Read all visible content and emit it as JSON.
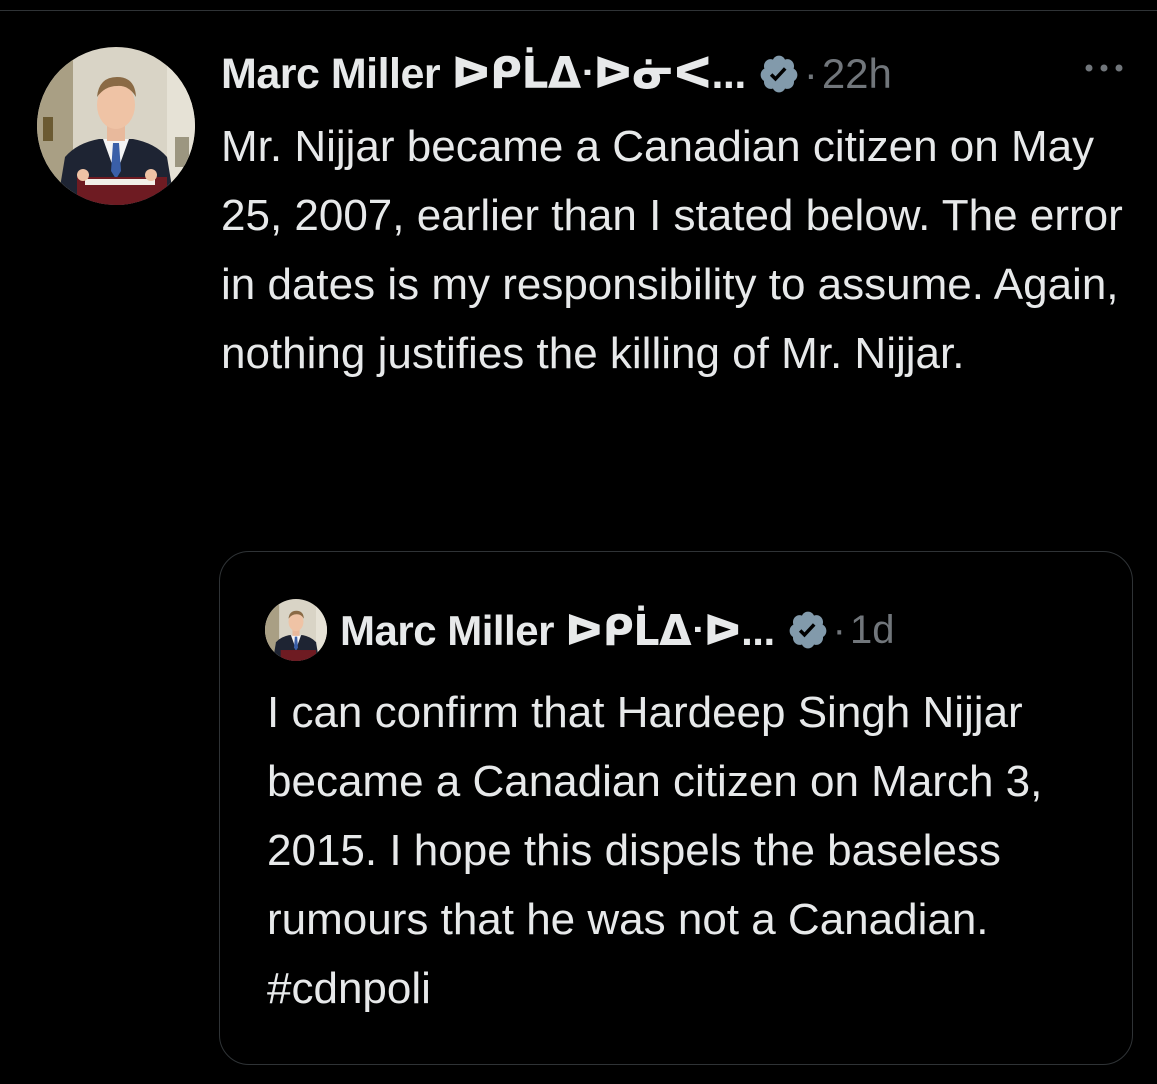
{
  "tweet": {
    "author_name": "Marc Miller ᐅᑭᒫᐃᐧᐅᓃᐸ...",
    "separator": "·",
    "time": "22h",
    "more_icon": "more-horizontal-icon",
    "verified_icon": "verified-badge-icon",
    "text": "Mr. Nijjar became a Canadian citizen on May 25, 2007, earlier than I stated below. The error in dates is my responsibility to assume. Again, nothing justifies the killing of Mr. Nijjar."
  },
  "quote": {
    "author_name": "Marc Miller ᐅᑭᒫᐃᐧᐅ...",
    "separator": "·",
    "time": "1d",
    "verified_icon": "verified-badge-icon",
    "text": "I can confirm that  Hardeep Singh Nijjar became a Canadian citizen on March 3, 2015. I hope this dispels the baseless rumours that he was not a Canadian. #cdnpoli"
  },
  "colors": {
    "background": "#000000",
    "text_primary": "#e7e9ea",
    "text_secondary": "#71767b",
    "border": "#2f3336",
    "verified_badge": "#829aab"
  }
}
